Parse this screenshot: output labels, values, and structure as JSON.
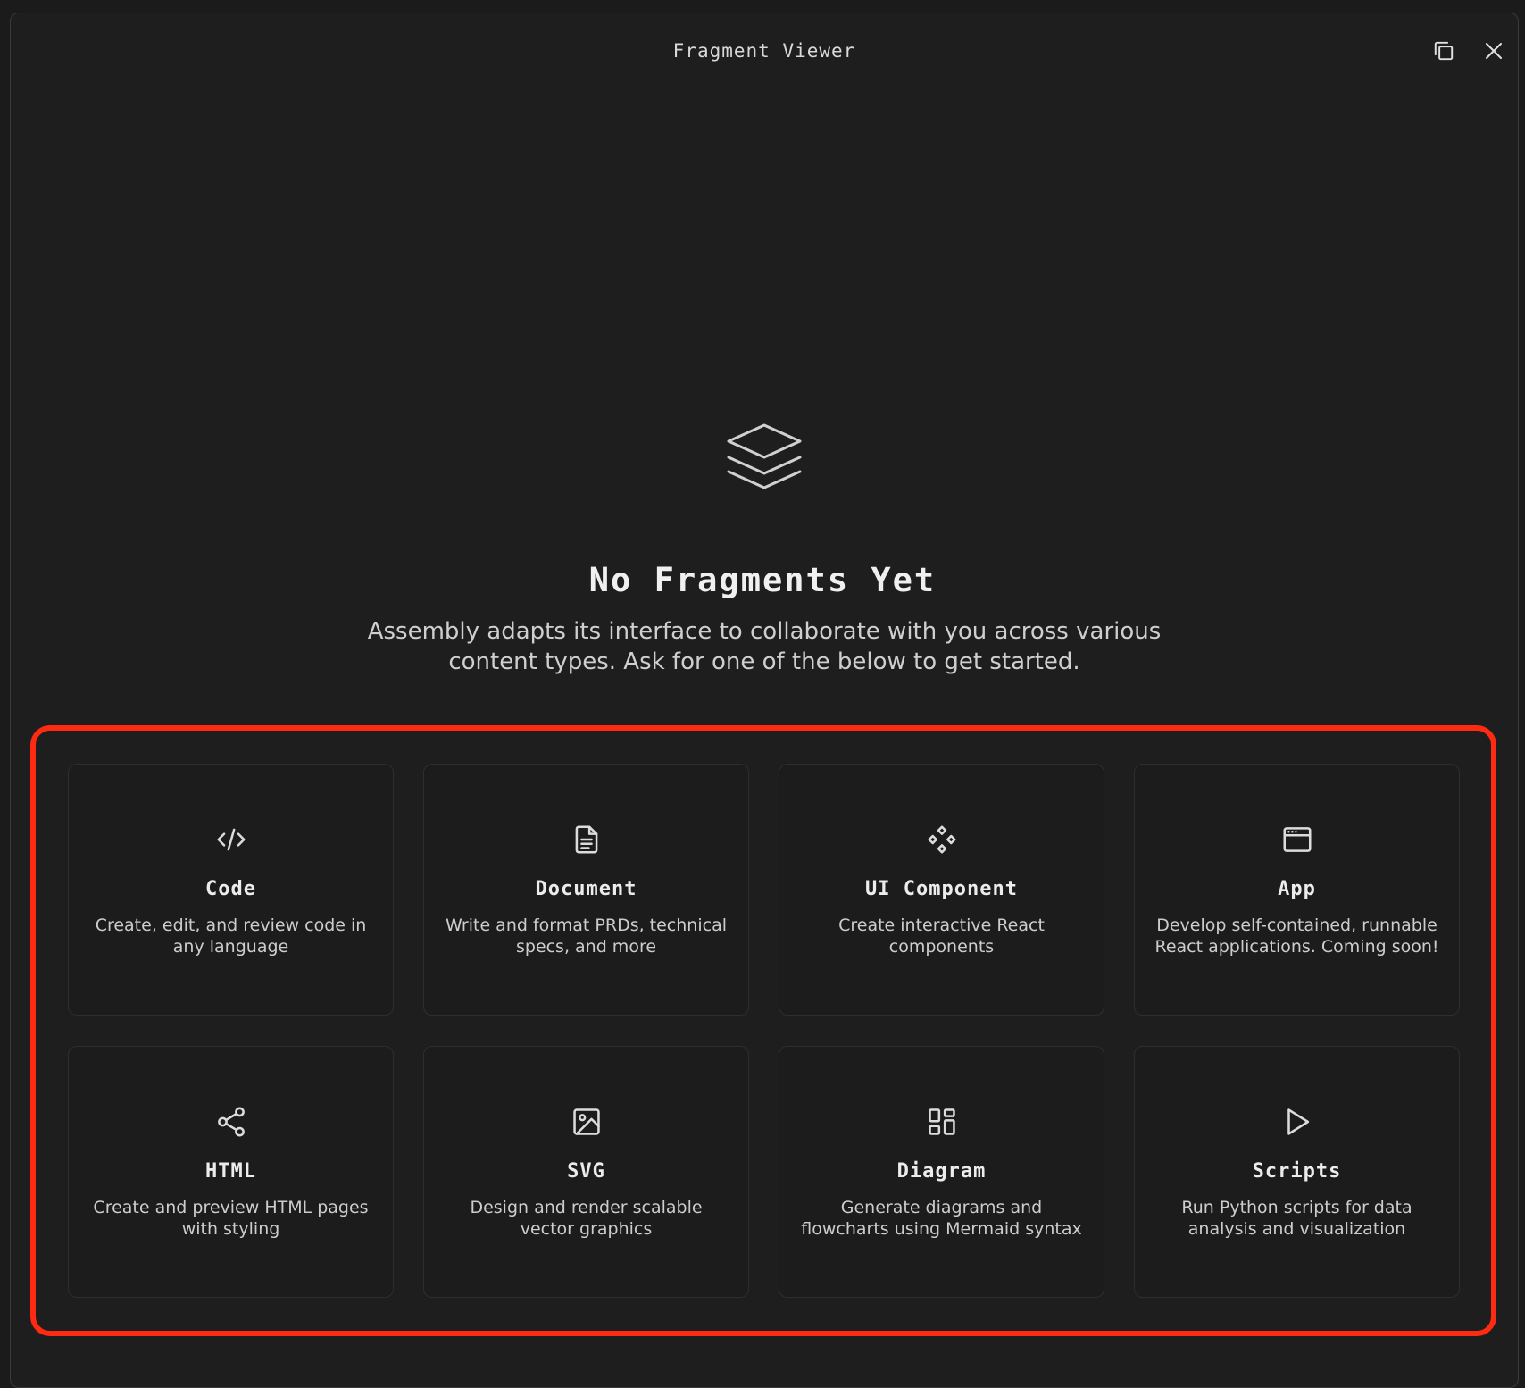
{
  "window": {
    "title": "Fragment Viewer",
    "icons": {
      "copy": "copy-window-icon",
      "close": "close-icon"
    }
  },
  "hero": {
    "icon": "layers-icon",
    "title": "No Fragments Yet",
    "description": "Assembly adapts its interface to collaborate with you across various content types. Ask for one of the below to get started."
  },
  "highlight_color": "#ff2a12",
  "cards": [
    {
      "icon": "code-icon",
      "title": "Code",
      "description": "Create, edit, and review code in any language"
    },
    {
      "icon": "document-icon",
      "title": "Document",
      "description": "Write and format PRDs, technical specs, and more"
    },
    {
      "icon": "component-icon",
      "title": "UI Component",
      "description": "Create interactive React components"
    },
    {
      "icon": "app-window-icon",
      "title": "App",
      "description": "Develop self-contained, runnable React applications. Coming soon!"
    },
    {
      "icon": "share-icon",
      "title": "HTML",
      "description": "Create and preview HTML pages with styling"
    },
    {
      "icon": "image-icon",
      "title": "SVG",
      "description": "Design and render scalable vector graphics"
    },
    {
      "icon": "diagram-icon",
      "title": "Diagram",
      "description": "Generate diagrams and flowcharts using Mermaid syntax"
    },
    {
      "icon": "play-icon",
      "title": "Scripts",
      "description": "Run Python scripts for data analysis and visualization"
    }
  ]
}
